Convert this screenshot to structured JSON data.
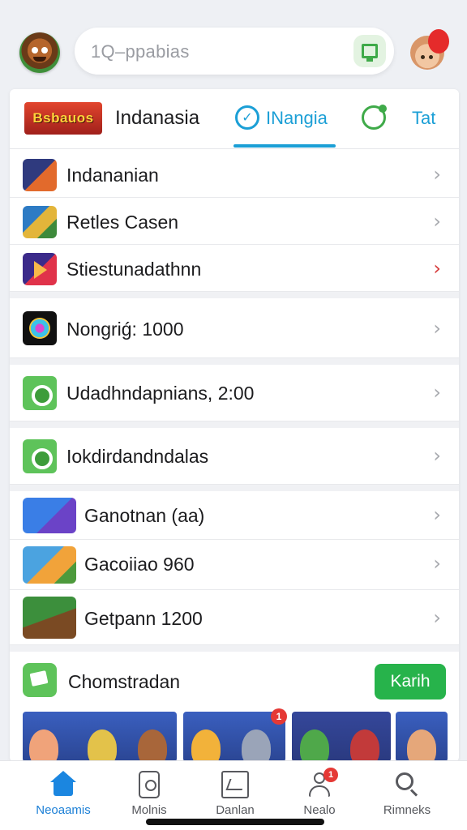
{
  "header": {
    "search_text": "1Q–ppabias",
    "left_avatar_icon": "monkey-avatar",
    "right_avatar_icon": "balloon-avatar",
    "search_button_icon": "green-square-icon"
  },
  "tabs": {
    "logo_text": "Bsbauos",
    "title": "Indanasia",
    "active_label": "INangia",
    "third_label": "Tat"
  },
  "list": [
    {
      "label": "Indananian",
      "chevron_color": "#a7a9ae"
    },
    {
      "label": "Retles Casen",
      "chevron_color": "#a7a9ae"
    },
    {
      "label": "Stiestunadathnn",
      "chevron_color": "#d63b3b"
    },
    {
      "label": "Nongriǵ: 1000",
      "chevron_color": "#a7a9ae"
    },
    {
      "label": "Udadhndapnians, 2:00",
      "chevron_color": "#a7a9ae"
    },
    {
      "label": "Iokdirdandndalas",
      "chevron_color": "#a7a9ae"
    },
    {
      "label": "Ganotnan (aa)",
      "chevron_color": "#a7a9ae"
    },
    {
      "label": "Gacoiiao 960",
      "chevron_color": "#a7a9ae"
    },
    {
      "label": "Getpann 1200",
      "chevron_color": "#a7a9ae"
    }
  ],
  "promo": {
    "label": "Chomstradan",
    "button_label": "Karih",
    "gallery_badge": "1"
  },
  "bottom_nav": [
    {
      "label": "Neoaamis",
      "icon": "home-icon",
      "active": true
    },
    {
      "label": "Molnis",
      "icon": "document-icon",
      "active": false
    },
    {
      "label": "Danlan",
      "icon": "chart-icon",
      "active": false
    },
    {
      "label": "Nealo",
      "icon": "user-icon",
      "badge": "1",
      "active": false
    },
    {
      "label": "Rimneks",
      "icon": "search-icon",
      "active": false
    }
  ],
  "colors": {
    "accent_blue": "#1b9fd6",
    "accent_green": "#27b34b",
    "badge_red": "#e53935"
  }
}
